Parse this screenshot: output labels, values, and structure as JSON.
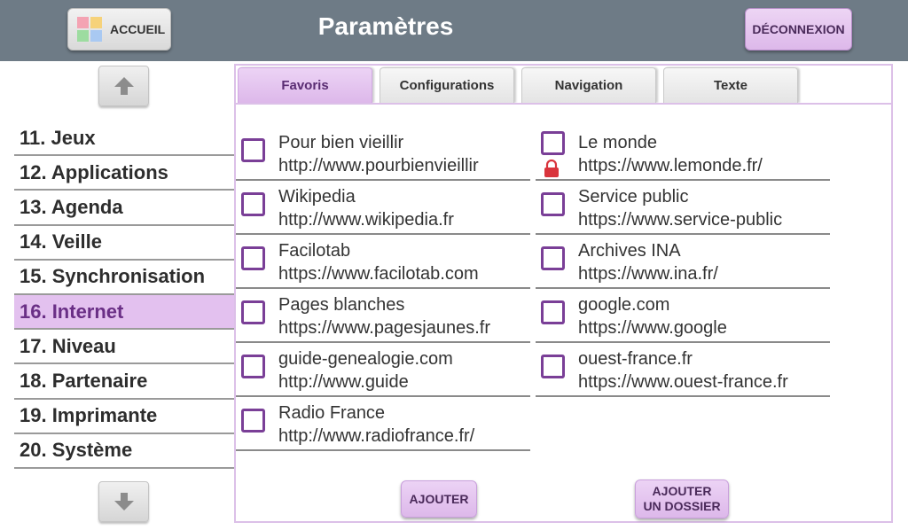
{
  "header": {
    "title": "Paramètres",
    "home_label": "ACCUEIL",
    "logout_label": "DÉCONNEXION",
    "home_logo_colors": [
      "#f4a3b3",
      "#f6d27a",
      "#9ddca0",
      "#a9c9f2"
    ]
  },
  "sidebar": {
    "items": [
      {
        "label": "11. Jeux"
      },
      {
        "label": "12. Applications"
      },
      {
        "label": "13. Agenda"
      },
      {
        "label": "14. Veille"
      },
      {
        "label": "15. Synchronisation"
      },
      {
        "label": "16. Internet",
        "active": true
      },
      {
        "label": "17. Niveau"
      },
      {
        "label": "18. Partenaire"
      },
      {
        "label": "19. Imprimante"
      },
      {
        "label": "20. Système"
      }
    ],
    "up_icon": "arrow-up-icon",
    "down_icon": "arrow-down-icon"
  },
  "tabs": [
    {
      "label": "Favoris",
      "active": true
    },
    {
      "label": "Configurations"
    },
    {
      "label": "Navigation"
    },
    {
      "label": "Texte"
    }
  ],
  "favorites": {
    "left": [
      {
        "name": "Pour bien vieillir",
        "url": "http://www.pourbienvieillir"
      },
      {
        "name": "Wikipedia",
        "url": "http://www.wikipedia.fr"
      },
      {
        "name": "Facilotab",
        "url": "https://www.facilotab.com"
      },
      {
        "name": "Pages blanches",
        "url": "https://www.pagesjaunes.fr"
      },
      {
        "name": "guide-genealogie.com",
        "url": "http://www.guide"
      },
      {
        "name": "Radio France",
        "url": "http://www.radiofrance.fr/"
      }
    ],
    "right": [
      {
        "name": "Le monde",
        "url": "https://www.lemonde.fr/",
        "locked": true
      },
      {
        "name": "Service public",
        "url": "https://www.service-public"
      },
      {
        "name": "Archives INA",
        "url": "https://www.ina.fr/"
      },
      {
        "name": "google.com",
        "url": "https://www.google"
      },
      {
        "name": "ouest-france.fr",
        "url": "https://www.ouest-france.fr"
      }
    ]
  },
  "actions": {
    "add_label": "AJOUTER",
    "add_folder_label_1": "AJOUTER",
    "add_folder_label_2": "UN DOSSIER"
  },
  "colors": {
    "header_bg": "#6e7b86",
    "accent": "#e3c1ef",
    "checkbox": "#7a3f97",
    "lock": "#d9343c"
  }
}
